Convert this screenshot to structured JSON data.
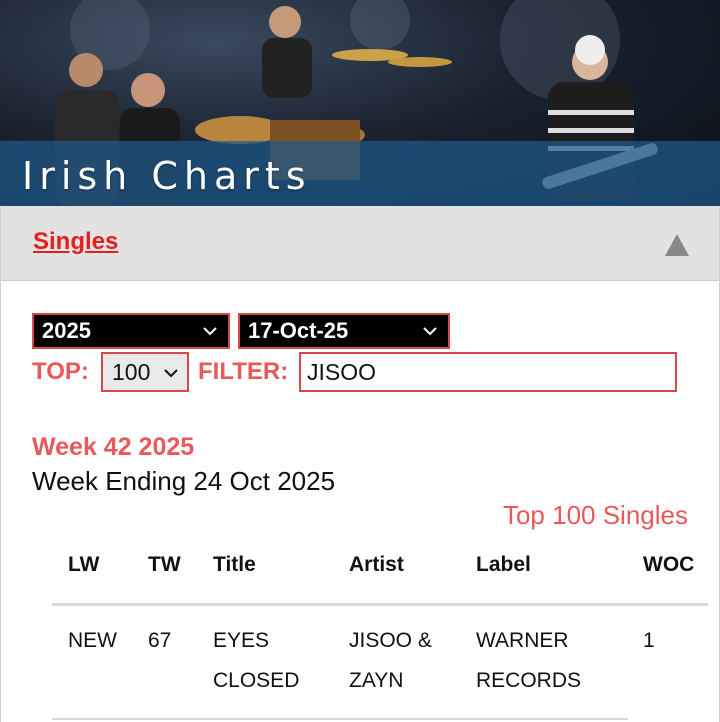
{
  "header": {
    "site_title": "Irish Charts"
  },
  "section": {
    "title": "Singles",
    "collapse_icon": "triangle-up-icon"
  },
  "controls": {
    "year_select": {
      "value": "2025"
    },
    "date_select": {
      "value": "17-Oct-25"
    },
    "top_label": "TOP:",
    "top_select": {
      "value": "100"
    },
    "filter_label": "FILTER:",
    "filter_input": {
      "value": "JISOO"
    }
  },
  "week": {
    "title": "Week 42 2025",
    "ending": "Week Ending 24 Oct 2025",
    "top_link": "Top 100 Singles"
  },
  "table": {
    "columns": [
      "LW",
      "TW",
      "Title",
      "Artist",
      "Label",
      "WOC"
    ],
    "rows": [
      {
        "lw": "NEW",
        "tw": "67",
        "title": [
          "EYES",
          "CLOSED"
        ],
        "artist": [
          "JISOO &",
          "ZAYN"
        ],
        "label": [
          "WARNER",
          "RECORDS"
        ],
        "woc": "1"
      }
    ]
  },
  "colors": {
    "accent_red": "#e4201f",
    "soft_red": "#e8595b",
    "banner_strip": "#1e5a8c"
  }
}
